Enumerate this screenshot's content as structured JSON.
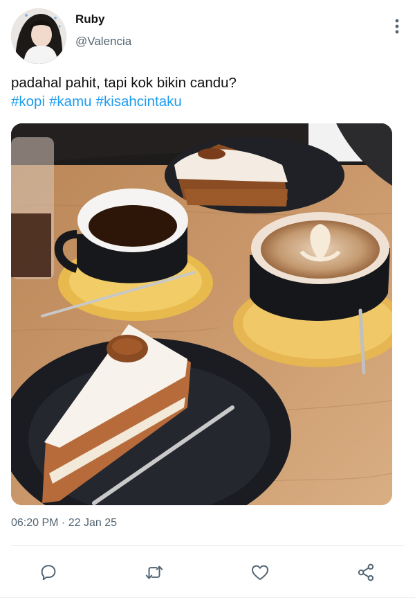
{
  "user": {
    "display_name": "Ruby",
    "handle": "@Valencia",
    "avatar_icon": "profile-photo"
  },
  "tweet": {
    "text": "padahal pahit, tapi kok bikin candu?",
    "hashtags": [
      "#kopi",
      "#kamu",
      "#kisahcintaku"
    ],
    "timestamp": "06:20 PM · 22 Jan 25",
    "photo_description_icon": "coffee-and-cake-photo"
  },
  "actions": {
    "reply_icon": "reply-icon",
    "retweet_icon": "retweet-icon",
    "like_icon": "heart-icon",
    "share_icon": "share-icon",
    "more_icon": "more-vertical-icon"
  },
  "colors": {
    "link": "#1d9bf0",
    "secondary_text": "#536471",
    "icon": "#536471",
    "divider": "#e6ecf0"
  }
}
